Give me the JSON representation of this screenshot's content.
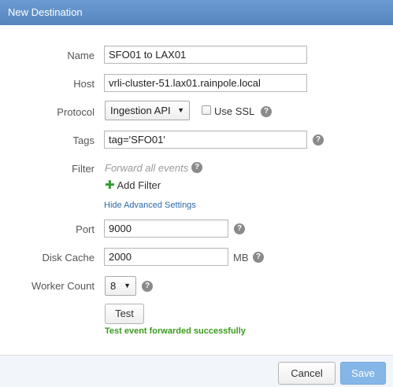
{
  "dialog": {
    "title": "New Destination"
  },
  "form": {
    "name": {
      "label": "Name",
      "value": "SFO01 to LAX01"
    },
    "host": {
      "label": "Host",
      "value": "vrli-cluster-51.lax01.rainpole.local"
    },
    "protocol": {
      "label": "Protocol",
      "selected": "Ingestion API",
      "use_ssl_label": "Use SSL",
      "use_ssl_checked": false
    },
    "tags": {
      "label": "Tags",
      "value": "tag='SFO01'"
    },
    "filter": {
      "label": "Filter",
      "placeholder": "Forward all events",
      "add_label": "Add Filter"
    },
    "advanced_link": "Hide Advanced Settings",
    "port": {
      "label": "Port",
      "value": "9000"
    },
    "disk_cache": {
      "label": "Disk Cache",
      "value": "2000",
      "unit": "MB"
    },
    "worker_count": {
      "label": "Worker Count",
      "selected": "8"
    },
    "test": {
      "label": "Test",
      "status": "Test event forwarded successfully",
      "status_color": "#3a9b1e"
    }
  },
  "footer": {
    "cancel_label": "Cancel",
    "save_label": "Save",
    "save_color": "#85b6e8"
  },
  "icons": {
    "help": "help-icon",
    "add": "plus-icon",
    "dropdown": "caret-down-icon"
  }
}
